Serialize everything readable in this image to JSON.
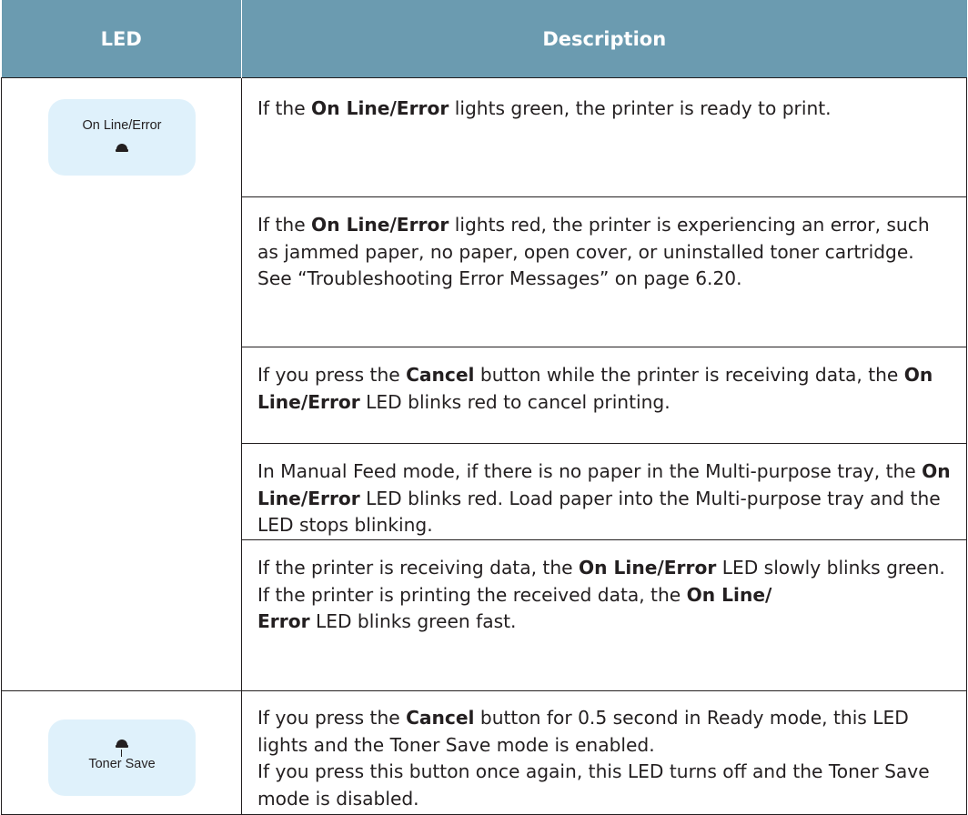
{
  "header": {
    "col_led": "LED",
    "col_description": "Description"
  },
  "panels": {
    "online": {
      "label": "On Line/Error",
      "icon": "led-indicator-icon"
    },
    "toner": {
      "label": "Toner Save",
      "icon": "led-indicator-icon"
    }
  },
  "rows": {
    "r1": {
      "p1": {
        "t1": "If the ",
        "b1": "On Line/Error",
        "t2": " lights green, the printer is ready to print."
      }
    },
    "r2": {
      "p1": {
        "t1": "If the ",
        "b1": "On Line/Error",
        "t2": " lights red, the printer is experiencing an error, such as jammed paper, no paper, open cover, or uninstalled toner cartridge. See “Troubleshooting Error Messages” on page 6.20."
      }
    },
    "r3": {
      "p1": {
        "t1": "If you press the ",
        "b1": "Cancel",
        "t2": " button while the printer is receiving data, the ",
        "b2": "On Line/Error",
        "t3": " LED blinks red to cancel printing."
      }
    },
    "r4": {
      "p1": {
        "t1": "In Manual Feed mode, if there is no paper in the Multi-purpose tray, the ",
        "b1": "On Line/Error",
        "t2": " LED blinks red. Load paper into the Multi-purpose tray and the LED stops blinking."
      }
    },
    "r5": {
      "p1": {
        "t1": "If the printer is receiving data, the ",
        "b1": "On Line/Error",
        "t2": " LED slowly blinks green."
      },
      "p2": {
        "t1": "If the printer is printing the received data, the ",
        "b1": "On Line/",
        "b2": "Error",
        "t2": " LED blinks green fast."
      }
    },
    "r6": {
      "p1": {
        "t1": "If you press the ",
        "b1": "Cancel",
        "t2": " button for 0.5 second in Ready mode, this LED lights and the Toner Save mode is enabled."
      },
      "p2": {
        "t1": "If you press this button once again, this LED turns off and the Toner Save mode is disabled."
      }
    }
  },
  "colors": {
    "header_bg": "#6b9bb0",
    "panel_bg": "#dff1fb",
    "border": "#231f20"
  }
}
